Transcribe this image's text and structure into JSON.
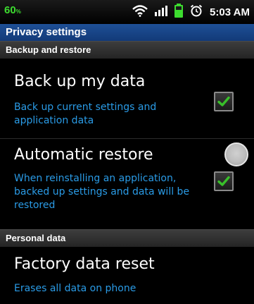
{
  "status_bar": {
    "battery_percent": "60",
    "battery_unit": "%",
    "time": "5:03 AM",
    "icons": [
      "wifi-icon",
      "signal-icon",
      "battery-icon",
      "alarm-icon"
    ]
  },
  "title_bar": {
    "title": "Privacy settings"
  },
  "sections": {
    "backup": {
      "header": "Backup and restore"
    },
    "personal": {
      "header": "Personal data"
    }
  },
  "items": {
    "backup_data": {
      "title": "Back up my data",
      "summary": "Back up current settings and application data",
      "checked": true
    },
    "auto_restore": {
      "title": "Automatic restore",
      "summary": "When reinstalling an application, backed up settings and data will be restored",
      "checked": true
    },
    "factory_reset": {
      "title": "Factory data reset",
      "summary": "Erases all data on phone"
    }
  },
  "colors": {
    "accent_blue": "#2a9be6",
    "battery_green": "#3ddc2f",
    "check_green": "#39c02a",
    "title_bar_blue": "#1e4f96"
  }
}
